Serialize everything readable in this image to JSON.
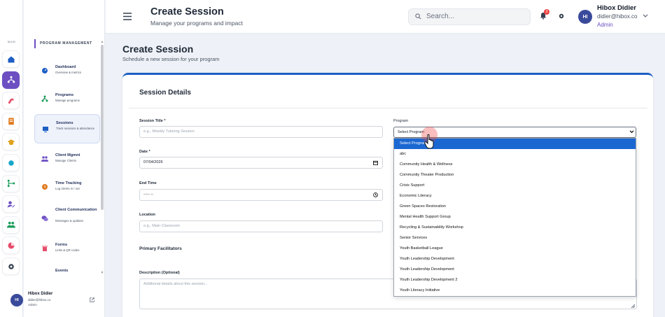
{
  "brand": {
    "logo_icon": "colorful-stripes-logo-icon"
  },
  "rail": {
    "label": "MAIN",
    "items": [
      {
        "icon": "home-icon",
        "color": "#1d5fc4"
      },
      {
        "icon": "network-icon",
        "color": "#ffffff",
        "active": true
      },
      {
        "icon": "satellite-icon",
        "color": "#e54d6a"
      },
      {
        "icon": "clipboard-icon",
        "color": "#e07a1f"
      },
      {
        "icon": "hat-icon",
        "color": "#e0a21f"
      },
      {
        "icon": "circle-icon",
        "color": "#15a6c9"
      },
      {
        "icon": "branch-icon",
        "color": "#1b9d5b"
      },
      {
        "icon": "edit-user-icon",
        "color": "#6d4fc2"
      },
      {
        "icon": "users-icon",
        "color": "#1b9d5b"
      },
      {
        "icon": "pie-chart-icon",
        "color": "#e54d6a"
      },
      {
        "icon": "gear-icon",
        "color": "#374151"
      }
    ]
  },
  "sidebar": {
    "section_title": "PROGRAM MANAGEMENT",
    "items": [
      {
        "title": "Dashboard",
        "sub": "Overview & metrics",
        "icon": "gauge-icon"
      },
      {
        "title": "Programs",
        "sub": "Manage programs",
        "icon": "network-icon"
      },
      {
        "title": "Sessions",
        "sub": "Track sessions & attendance",
        "icon": "monitor-icon",
        "active": true
      },
      {
        "title": "Client Mgmnt",
        "sub": "Manage Clients",
        "icon": "users-icon"
      },
      {
        "title": "Time Tracking",
        "sub": "Log clients in / out",
        "icon": "clock-icon"
      },
      {
        "title": "Client Communication",
        "sub": "Messages & updates",
        "icon": "chat-icon"
      },
      {
        "title": "Forms",
        "sub": "Links & QR codes",
        "icon": "trash-icon"
      },
      {
        "title": "Events",
        "sub": "",
        "icon": ""
      }
    ],
    "user": {
      "initials": "HI",
      "name": "Hibox Didier",
      "email": "didier@hibox.co",
      "role": "Admin"
    }
  },
  "header": {
    "title": "Create Session",
    "subtitle": "Manage your programs and impact",
    "search_placeholder": "Search...",
    "notification_count": "3",
    "user": {
      "initials": "HI",
      "name": "Hibox Didier",
      "email": "didier@hibox.co",
      "role": "Admin"
    }
  },
  "page": {
    "title": "Create Session",
    "subtitle": "Schedule a new session for your program"
  },
  "form": {
    "section_title": "Session Details",
    "session_title_label": "Session Title *",
    "session_title_placeholder": "e.g., Weekly Tutoring Session",
    "date_label": "Date *",
    "date_value": "07/04/2026",
    "end_time_label": "End Time",
    "end_time_value": "--:-- --",
    "location_label": "Location",
    "location_placeholder": "e.g., Main Classroom",
    "facilitators_label": "Primary Facilitators",
    "description_label": "Description (Optional)",
    "description_placeholder": "Additional details about this session...",
    "program_label": "Program",
    "program_value": "Select Program",
    "program_options": [
      "Select Program",
      "abc",
      "Community Health & Wellness",
      "Community Theater Production",
      "Crisis Support",
      "Economic Literacy",
      "Green Spaces Restoration",
      "Mental Health Support Group",
      "Recycling & Sustainability Workshop",
      "Senior Services",
      "Youth Basketball League",
      "Youth Leadership Development",
      "Youth Leadership Development",
      "Youth Leadership Development 2",
      "Youth Literacy Initiative"
    ]
  },
  "colors": {
    "accent": "#6d4fc2",
    "primary": "#1d5fc4",
    "selected_option": "#1a67d2"
  }
}
